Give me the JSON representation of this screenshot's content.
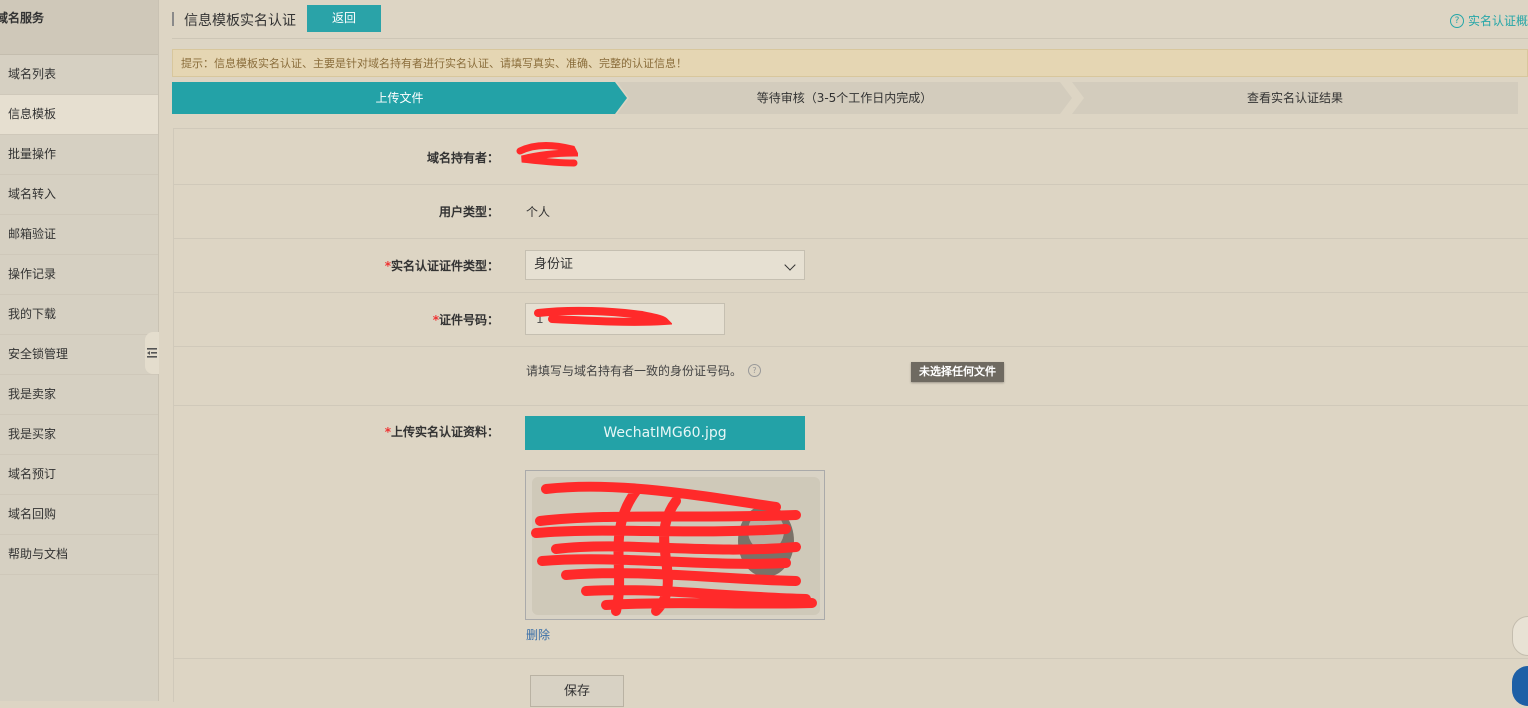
{
  "sidebar": {
    "title": "域名服务",
    "items": [
      "域名列表",
      "信息模板",
      "批量操作",
      "域名转入",
      "邮箱验证",
      "操作记录",
      "我的下载",
      "安全锁管理",
      "我是卖家",
      "我是买家",
      "域名预订",
      "域名回购",
      "帮助与文档"
    ],
    "active_index": 1
  },
  "header": {
    "title": "信息模板实名认证",
    "back_label": "返回",
    "help_label": "实名认证概"
  },
  "notice": "提示：信息模板实名认证、主要是针对域名持有者进行实名认证、请填写真实、准确、完整的认证信息！",
  "steps": [
    "上传文件",
    "等待审核（3-5个工作日内完成）",
    "查看实名认证结果"
  ],
  "form": {
    "holder_label": "域名持有者：",
    "user_type_label": "用户类型：",
    "user_type_value": "个人",
    "cert_type_label": "实名认证证件类型：",
    "cert_type_value": "身份证",
    "cert_number_label": "证件号码：",
    "cert_number_value": "1",
    "hint": "请填写与域名持有者一致的身份证号码。",
    "hint_icon": "?",
    "tooltip": "未选择任何文件",
    "upload_label": "上传实名认证资料：",
    "upload_file": "WechatIMG60.jpg",
    "delete_label": "删除",
    "save_label": "保存",
    "required_mark": "*"
  },
  "colors": {
    "accent": "#23a2a7",
    "redact": "#ff2a2a"
  }
}
